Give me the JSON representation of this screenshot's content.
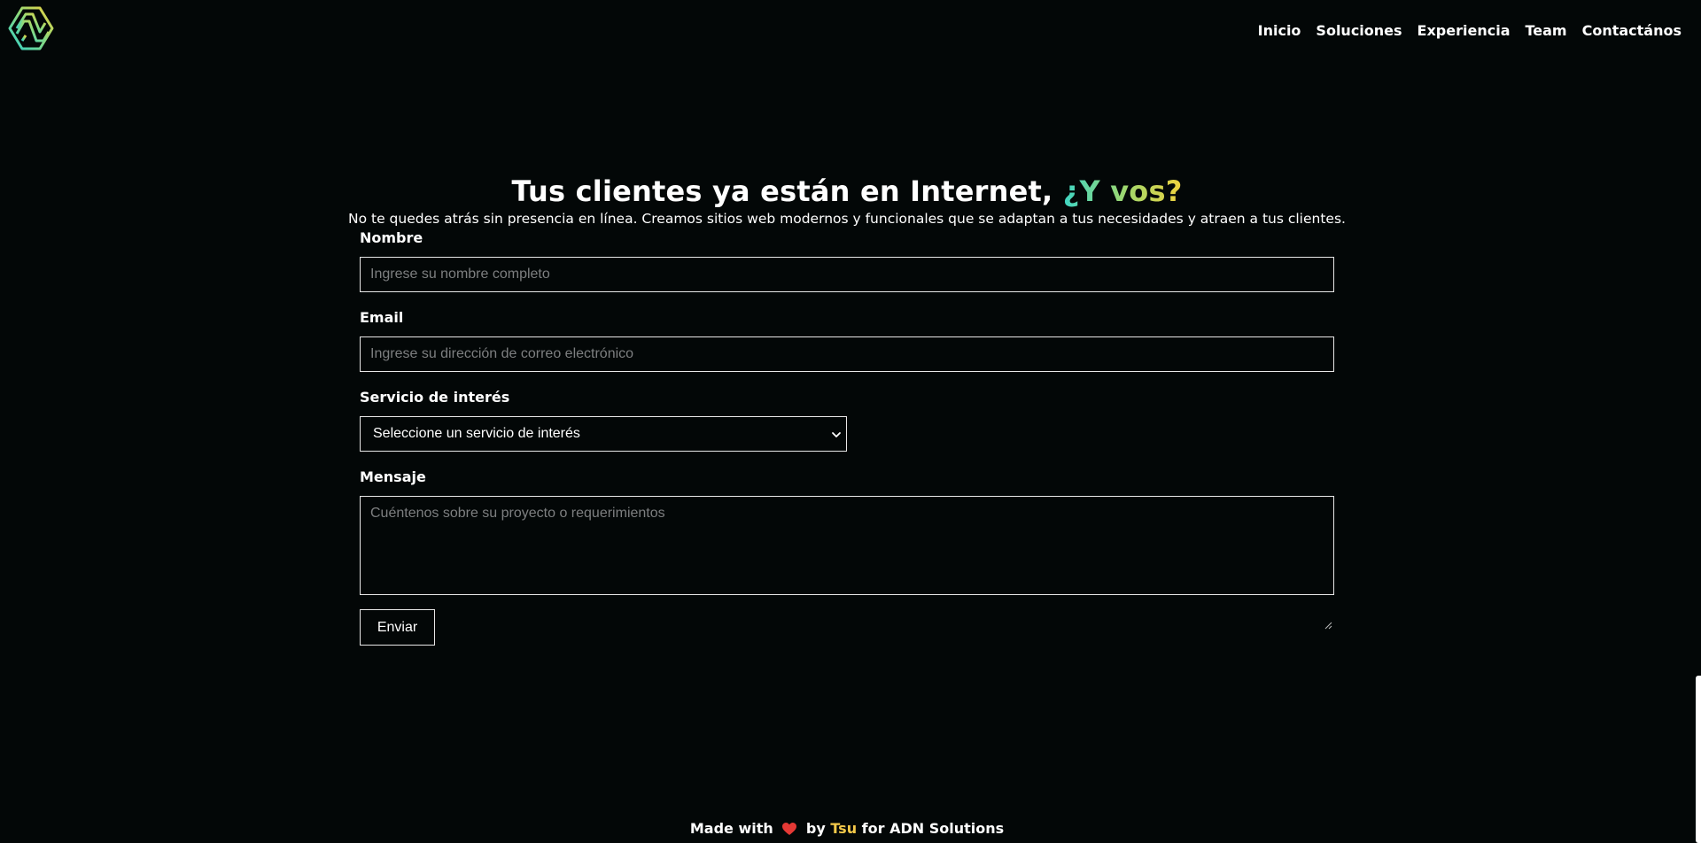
{
  "header": {
    "logo_icon": "adn-logo-icon",
    "nav": [
      {
        "label": "Inicio"
      },
      {
        "label": "Soluciones"
      },
      {
        "label": "Experiencia"
      },
      {
        "label": "Team"
      },
      {
        "label": "Contactános"
      }
    ]
  },
  "hero": {
    "title": "Tus clientes ya están en Internet,",
    "title_accent": "¿Y vos?",
    "subtitle": "No te quedes atrás sin presencia en línea. Creamos sitios web modernos y funcionales que se adaptan a tus necesidades y atraen a tus clientes."
  },
  "form": {
    "name_label": "Nombre",
    "name_placeholder": "Ingrese su nombre completo",
    "email_label": "Email",
    "email_placeholder": "Ingrese su dirección de correo electrónico",
    "service_label": "Servicio de interés",
    "service_selected": "Seleccione un servicio de interés",
    "message_label": "Mensaje",
    "message_placeholder": "Cuéntenos sobre su proyecto o requerimientos",
    "submit_label": "Enviar"
  },
  "footer": {
    "made_with": "Made with",
    "heart_icon": "heart-icon",
    "by": "by",
    "author": "Tsu",
    "for": "for ADN Solutions"
  },
  "colors": {
    "background": "#030707",
    "text": "#ffffff",
    "accent_gradient_start": "#3fd6c4",
    "accent_gradient_end": "#f0d23e",
    "author": "#f4c94a",
    "heart": "#e53935"
  }
}
